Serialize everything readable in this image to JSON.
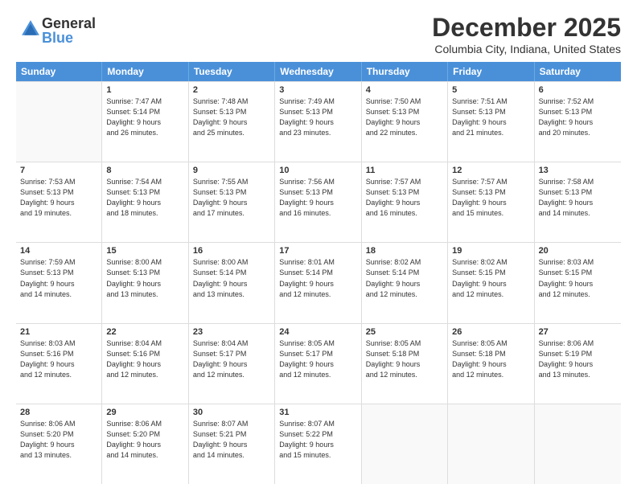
{
  "header": {
    "logo_general": "General",
    "logo_blue": "Blue",
    "month": "December 2025",
    "location": "Columbia City, Indiana, United States"
  },
  "weekdays": [
    "Sunday",
    "Monday",
    "Tuesday",
    "Wednesday",
    "Thursday",
    "Friday",
    "Saturday"
  ],
  "rows": [
    [
      {
        "day": "",
        "info": ""
      },
      {
        "day": "1",
        "info": "Sunrise: 7:47 AM\nSunset: 5:14 PM\nDaylight: 9 hours\nand 26 minutes."
      },
      {
        "day": "2",
        "info": "Sunrise: 7:48 AM\nSunset: 5:13 PM\nDaylight: 9 hours\nand 25 minutes."
      },
      {
        "day": "3",
        "info": "Sunrise: 7:49 AM\nSunset: 5:13 PM\nDaylight: 9 hours\nand 23 minutes."
      },
      {
        "day": "4",
        "info": "Sunrise: 7:50 AM\nSunset: 5:13 PM\nDaylight: 9 hours\nand 22 minutes."
      },
      {
        "day": "5",
        "info": "Sunrise: 7:51 AM\nSunset: 5:13 PM\nDaylight: 9 hours\nand 21 minutes."
      },
      {
        "day": "6",
        "info": "Sunrise: 7:52 AM\nSunset: 5:13 PM\nDaylight: 9 hours\nand 20 minutes."
      }
    ],
    [
      {
        "day": "7",
        "info": "Sunrise: 7:53 AM\nSunset: 5:13 PM\nDaylight: 9 hours\nand 19 minutes."
      },
      {
        "day": "8",
        "info": "Sunrise: 7:54 AM\nSunset: 5:13 PM\nDaylight: 9 hours\nand 18 minutes."
      },
      {
        "day": "9",
        "info": "Sunrise: 7:55 AM\nSunset: 5:13 PM\nDaylight: 9 hours\nand 17 minutes."
      },
      {
        "day": "10",
        "info": "Sunrise: 7:56 AM\nSunset: 5:13 PM\nDaylight: 9 hours\nand 16 minutes."
      },
      {
        "day": "11",
        "info": "Sunrise: 7:57 AM\nSunset: 5:13 PM\nDaylight: 9 hours\nand 16 minutes."
      },
      {
        "day": "12",
        "info": "Sunrise: 7:57 AM\nSunset: 5:13 PM\nDaylight: 9 hours\nand 15 minutes."
      },
      {
        "day": "13",
        "info": "Sunrise: 7:58 AM\nSunset: 5:13 PM\nDaylight: 9 hours\nand 14 minutes."
      }
    ],
    [
      {
        "day": "14",
        "info": "Sunrise: 7:59 AM\nSunset: 5:13 PM\nDaylight: 9 hours\nand 14 minutes."
      },
      {
        "day": "15",
        "info": "Sunrise: 8:00 AM\nSunset: 5:13 PM\nDaylight: 9 hours\nand 13 minutes."
      },
      {
        "day": "16",
        "info": "Sunrise: 8:00 AM\nSunset: 5:14 PM\nDaylight: 9 hours\nand 13 minutes."
      },
      {
        "day": "17",
        "info": "Sunrise: 8:01 AM\nSunset: 5:14 PM\nDaylight: 9 hours\nand 12 minutes."
      },
      {
        "day": "18",
        "info": "Sunrise: 8:02 AM\nSunset: 5:14 PM\nDaylight: 9 hours\nand 12 minutes."
      },
      {
        "day": "19",
        "info": "Sunrise: 8:02 AM\nSunset: 5:15 PM\nDaylight: 9 hours\nand 12 minutes."
      },
      {
        "day": "20",
        "info": "Sunrise: 8:03 AM\nSunset: 5:15 PM\nDaylight: 9 hours\nand 12 minutes."
      }
    ],
    [
      {
        "day": "21",
        "info": "Sunrise: 8:03 AM\nSunset: 5:16 PM\nDaylight: 9 hours\nand 12 minutes."
      },
      {
        "day": "22",
        "info": "Sunrise: 8:04 AM\nSunset: 5:16 PM\nDaylight: 9 hours\nand 12 minutes."
      },
      {
        "day": "23",
        "info": "Sunrise: 8:04 AM\nSunset: 5:17 PM\nDaylight: 9 hours\nand 12 minutes."
      },
      {
        "day": "24",
        "info": "Sunrise: 8:05 AM\nSunset: 5:17 PM\nDaylight: 9 hours\nand 12 minutes."
      },
      {
        "day": "25",
        "info": "Sunrise: 8:05 AM\nSunset: 5:18 PM\nDaylight: 9 hours\nand 12 minutes."
      },
      {
        "day": "26",
        "info": "Sunrise: 8:05 AM\nSunset: 5:18 PM\nDaylight: 9 hours\nand 12 minutes."
      },
      {
        "day": "27",
        "info": "Sunrise: 8:06 AM\nSunset: 5:19 PM\nDaylight: 9 hours\nand 13 minutes."
      }
    ],
    [
      {
        "day": "28",
        "info": "Sunrise: 8:06 AM\nSunset: 5:20 PM\nDaylight: 9 hours\nand 13 minutes."
      },
      {
        "day": "29",
        "info": "Sunrise: 8:06 AM\nSunset: 5:20 PM\nDaylight: 9 hours\nand 14 minutes."
      },
      {
        "day": "30",
        "info": "Sunrise: 8:07 AM\nSunset: 5:21 PM\nDaylight: 9 hours\nand 14 minutes."
      },
      {
        "day": "31",
        "info": "Sunrise: 8:07 AM\nSunset: 5:22 PM\nDaylight: 9 hours\nand 15 minutes."
      },
      {
        "day": "",
        "info": ""
      },
      {
        "day": "",
        "info": ""
      },
      {
        "day": "",
        "info": ""
      }
    ]
  ]
}
